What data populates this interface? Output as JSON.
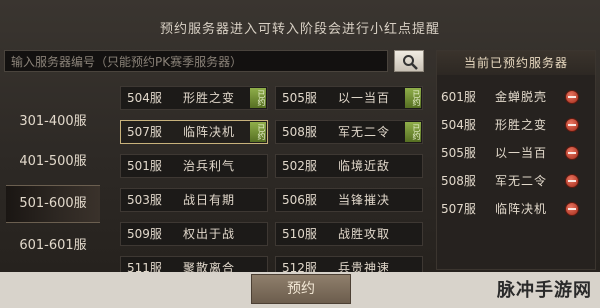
{
  "notice": "预约服务器进入可转入阶段会进行小红点提醒",
  "search": {
    "placeholder": "输入服务器编号（只能预约PK赛季服务器）",
    "icon": "search-icon"
  },
  "ranges": [
    {
      "label": "301-400服",
      "active": false
    },
    {
      "label": "401-500服",
      "active": false
    },
    {
      "label": "501-600服",
      "active": true
    },
    {
      "label": "601-601服",
      "active": false
    }
  ],
  "servers": [
    {
      "num": "504服",
      "name": "形胜之变",
      "tag": "已约"
    },
    {
      "num": "505服",
      "name": "以一当百",
      "tag": "已约"
    },
    {
      "num": "507服",
      "name": "临阵决机",
      "tag": "已约",
      "selected": true
    },
    {
      "num": "508服",
      "name": "军无二令",
      "tag": "已约"
    },
    {
      "num": "501服",
      "name": "治兵利气"
    },
    {
      "num": "502服",
      "name": "临境近敌"
    },
    {
      "num": "503服",
      "name": "战日有期"
    },
    {
      "num": "506服",
      "name": "当锋摧决"
    },
    {
      "num": "509服",
      "name": "权出于战"
    },
    {
      "num": "510服",
      "name": "战胜攻取"
    },
    {
      "num": "511服",
      "name": "聚散离合"
    },
    {
      "num": "512服",
      "name": "兵贵神速"
    }
  ],
  "reserved": {
    "title": "当前已预约服务器",
    "items": [
      {
        "num": "601服",
        "name": "金蝉脱壳"
      },
      {
        "num": "504服",
        "name": "形胜之变"
      },
      {
        "num": "505服",
        "name": "以一当百"
      },
      {
        "num": "508服",
        "name": "军无二令"
      },
      {
        "num": "507服",
        "name": "临阵决机"
      }
    ]
  },
  "reserve_button": "预约",
  "watermark": "脉冲手游网"
}
